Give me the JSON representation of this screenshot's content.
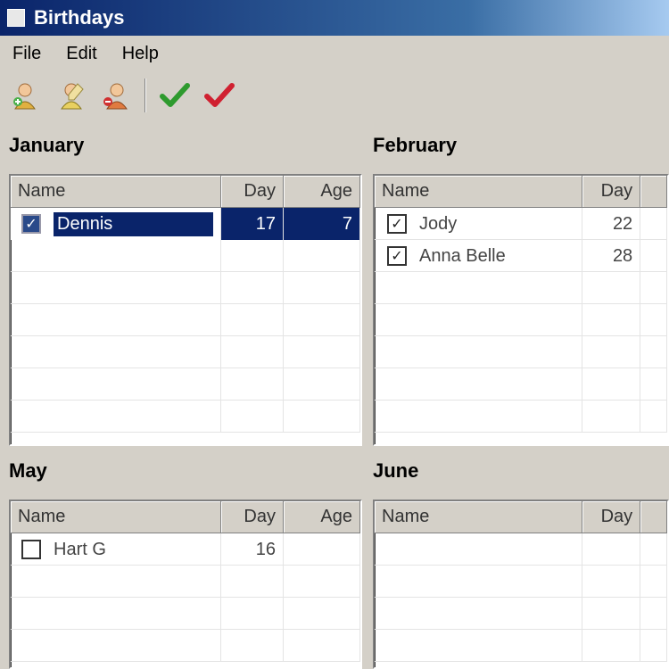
{
  "window": {
    "title": "Birthdays"
  },
  "menu": {
    "file": "File",
    "edit": "Edit",
    "help": "Help"
  },
  "toolbar": {
    "buttons": [
      {
        "icon": "add-person-icon"
      },
      {
        "icon": "edit-person-icon"
      },
      {
        "icon": "delete-person-icon"
      },
      {
        "icon": "green-check-icon",
        "color": "#2e9a2e"
      },
      {
        "icon": "red-check-icon",
        "color": "#d02030"
      }
    ]
  },
  "columns": {
    "name": "Name",
    "day": "Day",
    "age": "Age"
  },
  "months": {
    "january": {
      "title": "January",
      "rows": [
        {
          "checked": true,
          "name": "Dennis",
          "day": "17",
          "age": "7",
          "selected": true
        }
      ]
    },
    "february": {
      "title": "February",
      "rows": [
        {
          "checked": true,
          "name": "Jody",
          "day": "22",
          "age": ""
        },
        {
          "checked": true,
          "name": "Anna Belle",
          "day": "28",
          "age": ""
        }
      ]
    },
    "may": {
      "title": "May",
      "rows": [
        {
          "checked": false,
          "name": "Hart G",
          "day": "16",
          "age": ""
        }
      ]
    },
    "june": {
      "title": "June",
      "rows": []
    }
  },
  "colors": {
    "selection": "#0a246a",
    "face": "#d4d0c8"
  }
}
